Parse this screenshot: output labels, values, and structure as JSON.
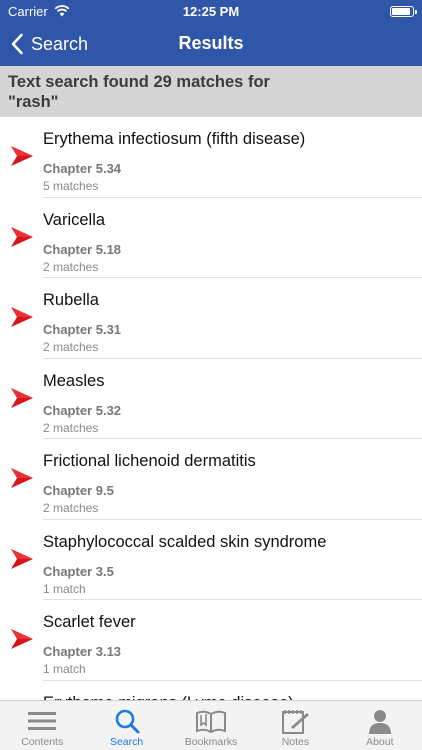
{
  "status": {
    "carrier": "Carrier",
    "time": "12:25 PM",
    "battery_level": 0.95
  },
  "nav": {
    "back_label": "Search",
    "title": "Results"
  },
  "banner": {
    "line1": "Text search found 29 matches for",
    "line2": "\"rash\""
  },
  "results": [
    {
      "title": "Erythema infectiosum (fifth disease)",
      "chapter": "Chapter 5.34",
      "matches": "5 matches"
    },
    {
      "title": "Varicella",
      "chapter": "Chapter 5.18",
      "matches": "2 matches"
    },
    {
      "title": "Rubella",
      "chapter": "Chapter 5.31",
      "matches": "2 matches"
    },
    {
      "title": "Measles",
      "chapter": "Chapter 5.32",
      "matches": "2 matches"
    },
    {
      "title": "Frictional lichenoid dermatitis",
      "chapter": "Chapter 9.5",
      "matches": "2 matches"
    },
    {
      "title": "Staphylococcal scalded skin syndrome",
      "chapter": "Chapter 3.5",
      "matches": "1 match"
    },
    {
      "title": "Scarlet fever",
      "chapter": "Chapter 3.13",
      "matches": "1 match"
    },
    {
      "title": "Erythema migrans (Lyme disease)",
      "chapter": "",
      "matches": ""
    }
  ],
  "tabs": [
    {
      "label": "Contents",
      "icon": "list-icon",
      "active": false
    },
    {
      "label": "Search",
      "icon": "search-icon",
      "active": true
    },
    {
      "label": "Bookmarks",
      "icon": "book-icon",
      "active": false
    },
    {
      "label": "Notes",
      "icon": "notes-icon",
      "active": false
    },
    {
      "label": "About",
      "icon": "person-icon",
      "active": false
    }
  ],
  "colors": {
    "nav_bg": "#2f56a8",
    "banner_bg": "#d5d5d5",
    "arrow_red": "#d8141b",
    "tab_active": "#1a7be0",
    "tab_inactive": "#8a8a8a"
  }
}
